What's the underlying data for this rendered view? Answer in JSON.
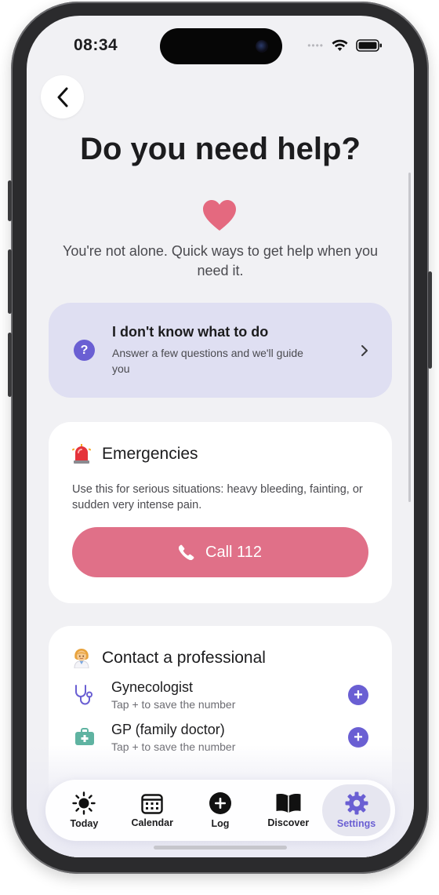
{
  "status_bar": {
    "time": "08:34"
  },
  "page": {
    "title": "Do you need help?",
    "intro": "You're not alone. Quick ways to get help when you need it."
  },
  "guide_card": {
    "title": "I don't know what to do",
    "subtitle": "Answer a few questions and we'll guide you"
  },
  "emergency_card": {
    "title": "Emergencies",
    "description": "Use this for serious situations: heavy bleeding, fainting, or sudden very intense pain.",
    "call_label": "Call 112"
  },
  "professional_card": {
    "title": "Contact a professional",
    "items": [
      {
        "name": "Gynecologist",
        "hint": "Tap + to save the number",
        "icon": "stethoscope-icon"
      },
      {
        "name": "GP (family doctor)",
        "hint": "Tap + to save the number",
        "icon": "medical-kit-icon"
      }
    ]
  },
  "tab_bar": {
    "active": "Settings",
    "items": [
      {
        "label": "Today",
        "icon": "sun-icon"
      },
      {
        "label": "Calendar",
        "icon": "calendar-icon"
      },
      {
        "label": "Log",
        "icon": "plus-circle-icon"
      },
      {
        "label": "Discover",
        "icon": "book-icon"
      },
      {
        "label": "Settings",
        "icon": "gear-icon"
      }
    ]
  },
  "colors": {
    "accent": "#6a5fd3",
    "emergency": "#e07088",
    "heart": "#e4697f",
    "guide_bg": "#dfdff2",
    "screen_bg": "#f1f1f4"
  }
}
